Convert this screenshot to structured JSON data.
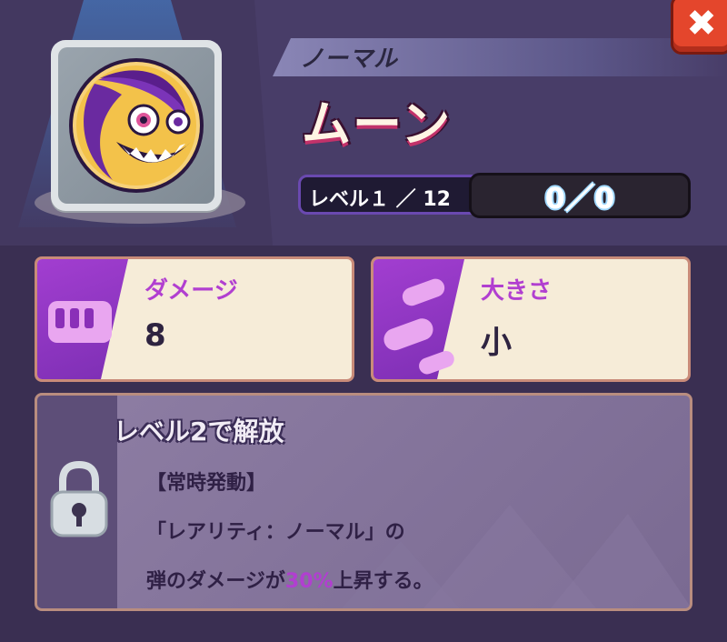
{
  "header": {
    "rarity": "ノーマル",
    "name": "ムーン",
    "level_label": "レベル１ ／ 12",
    "count": "0／0",
    "close_icon": "close-icon"
  },
  "stats": [
    {
      "label": "ダメージ",
      "value": "8",
      "icon": "fist-icon"
    },
    {
      "label": "大きさ",
      "value": "小",
      "icon": "bullet-icon"
    }
  ],
  "unlock": {
    "title": "レベル2で解放",
    "line1": "【常時発動】",
    "line2": "「レアリティ：ノーマル」の",
    "line3_before": "弾のダメージが",
    "line3_highlight": "30%",
    "line3_after": "上昇する。",
    "icon": "lock-icon"
  },
  "colors": {
    "accent_purple": "#b13fd0",
    "close_red": "#e4462c",
    "card_bg": "#f6ecd8"
  }
}
